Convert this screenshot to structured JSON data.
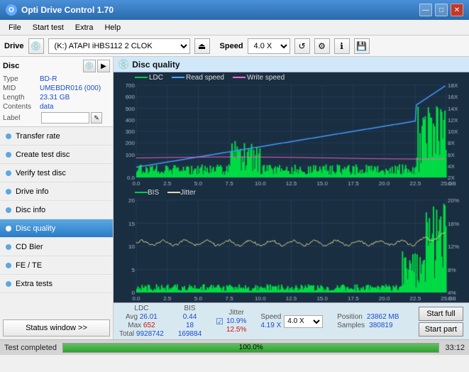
{
  "app": {
    "title": "Opti Drive Control 1.70",
    "icon": "O"
  },
  "title_controls": {
    "minimize": "—",
    "maximize": "□",
    "close": "✕"
  },
  "menu": {
    "items": [
      "File",
      "Start test",
      "Extra",
      "Help"
    ]
  },
  "drive_toolbar": {
    "drive_label": "Drive",
    "drive_value": "(K:)  ATAPI iHBS112  2 CLOK",
    "speed_label": "Speed",
    "speed_value": "4.0 X"
  },
  "disc": {
    "title": "Disc",
    "type_label": "Type",
    "type_value": "BD-R",
    "mid_label": "MID",
    "mid_value": "UMEBDR016 (000)",
    "length_label": "Length",
    "length_value": "23.31 GB",
    "contents_label": "Contents",
    "contents_value": "data",
    "label_label": "Label",
    "label_value": ""
  },
  "nav": {
    "items": [
      {
        "id": "transfer-rate",
        "label": "Transfer rate"
      },
      {
        "id": "create-test-disc",
        "label": "Create test disc"
      },
      {
        "id": "verify-test-disc",
        "label": "Verify test disc"
      },
      {
        "id": "drive-info",
        "label": "Drive info"
      },
      {
        "id": "disc-info",
        "label": "Disc info"
      },
      {
        "id": "disc-quality",
        "label": "Disc quality",
        "active": true
      },
      {
        "id": "cd-bier",
        "label": "CD Bier"
      },
      {
        "id": "fe-te",
        "label": "FE / TE"
      },
      {
        "id": "extra-tests",
        "label": "Extra tests"
      }
    ],
    "status_btn": "Status window >>"
  },
  "disc_quality": {
    "title": "Disc quality",
    "legend_top": [
      "LDC",
      "Read speed",
      "Write speed"
    ],
    "legend_bottom": [
      "BIS",
      "Jitter"
    ],
    "y_left_top": [
      "700",
      "600",
      "500",
      "400",
      "300",
      "200",
      "100",
      "0.0"
    ],
    "y_right_top": [
      "18X",
      "16X",
      "14X",
      "12X",
      "10X",
      "8X",
      "6X",
      "4X",
      "2X"
    ],
    "y_left_bottom": [
      "20",
      "15",
      "10",
      "5"
    ],
    "y_right_bottom": [
      "20%",
      "16%",
      "12%",
      "8%",
      "4%"
    ],
    "x_labels": [
      "0.0",
      "2.5",
      "5.0",
      "7.5",
      "10.0",
      "12.5",
      "15.0",
      "17.5",
      "20.0",
      "22.5",
      "25.0 GB"
    ]
  },
  "stats": {
    "ldc_label": "LDC",
    "bis_label": "BIS",
    "jitter_label": "Jitter",
    "speed_label": "Speed",
    "avg_label": "Avg",
    "max_label": "Max",
    "total_label": "Total",
    "ldc_avg": "26.01",
    "ldc_max": "652",
    "ldc_total": "9928742",
    "bis_avg": "0.44",
    "bis_max": "18",
    "bis_total": "169884",
    "jitter_avg": "10.9%",
    "jitter_max": "12.5%",
    "speed_val": "4.19 X",
    "speed_select": "4.0 X",
    "position_label": "Position",
    "position_val": "23862 MB",
    "samples_label": "Samples",
    "samples_val": "380819",
    "start_full_btn": "Start full",
    "start_part_btn": "Start part"
  },
  "bottom": {
    "status_text": "Test completed",
    "progress_val": 100,
    "progress_text": "100.0%",
    "time_text": "33:12"
  }
}
